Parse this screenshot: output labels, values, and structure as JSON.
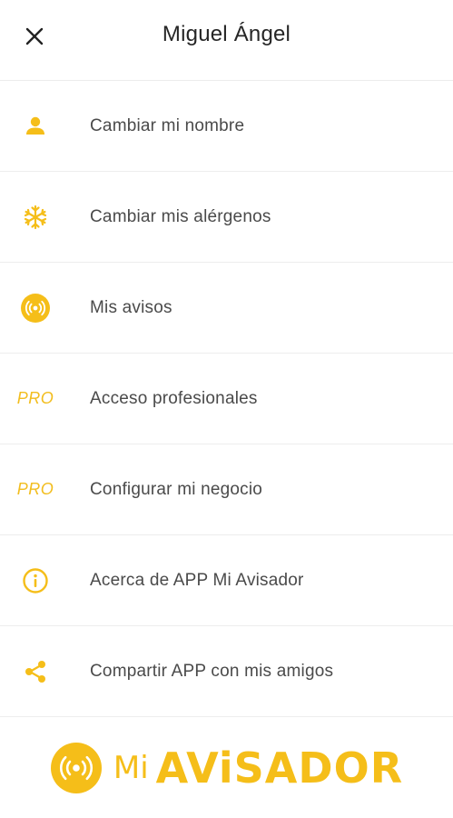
{
  "header": {
    "title": "Miguel Ángel"
  },
  "menu": {
    "items": [
      {
        "label": "Cambiar mi nombre",
        "icon": "person-icon"
      },
      {
        "label": "Cambiar mis alérgenos",
        "icon": "snowflake-icon"
      },
      {
        "label": "Mis avisos",
        "icon": "broadcast-icon"
      },
      {
        "label": "Acceso profesionales",
        "icon": "pro-badge",
        "icon_text": "PRO"
      },
      {
        "label": "Configurar mi negocio",
        "icon": "pro-badge",
        "icon_text": "PRO"
      },
      {
        "label": "Acerca de APP Mi Avisador",
        "icon": "info-icon"
      },
      {
        "label": "Compartir APP con mis amigos",
        "icon": "share-icon"
      }
    ]
  },
  "logo": {
    "mi": "Mi",
    "name": "AViSADOR"
  },
  "colors": {
    "accent": "#f5be19",
    "text": "#4a4a4a",
    "divider": "#ededed"
  }
}
